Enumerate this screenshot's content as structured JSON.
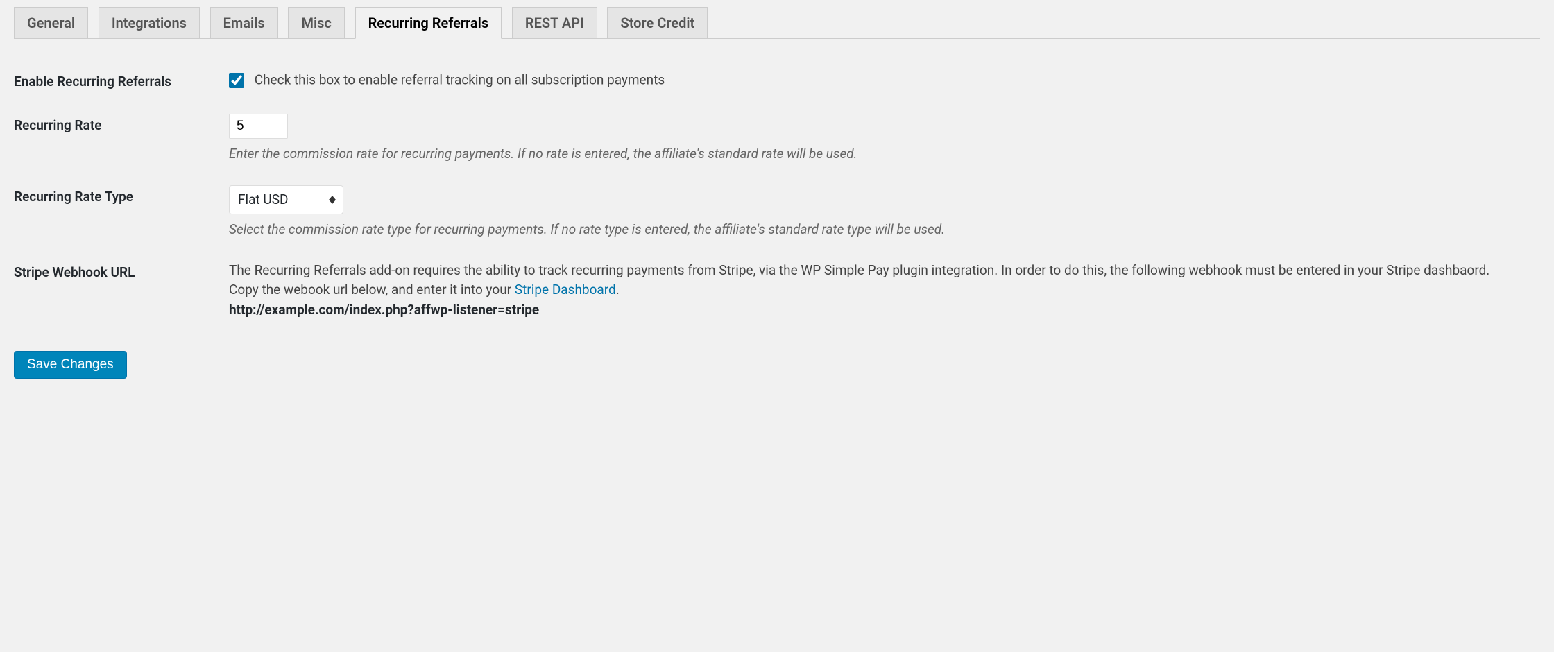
{
  "tabs": {
    "general": "General",
    "integrations": "Integrations",
    "emails": "Emails",
    "misc": "Misc",
    "recurring_referrals": "Recurring Referrals",
    "rest_api": "REST API",
    "store_credit": "Store Credit"
  },
  "fields": {
    "enable_recurring": {
      "label": "Enable Recurring Referrals",
      "description": "Check this box to enable referral tracking on all subscription payments",
      "checked": true
    },
    "recurring_rate": {
      "label": "Recurring Rate",
      "value": "5",
      "description": "Enter the commission rate for recurring payments. If no rate is entered, the affiliate's standard rate will be used."
    },
    "recurring_rate_type": {
      "label": "Recurring Rate Type",
      "selected": "Flat USD",
      "description": "Select the commission rate type for recurring payments. If no rate type is entered, the affiliate's standard rate type will be used."
    },
    "stripe_webhook": {
      "label": "Stripe Webhook URL",
      "text1": "The Recurring Referrals add-on requires the ability to track recurring payments from Stripe, via the WP Simple Pay plugin integration. In order to do this, the following webhook must be entered in your Stripe dashbaord.",
      "text2_prefix": "Copy the webook url below, and enter it into your ",
      "link_text": "Stripe Dashboard",
      "text2_suffix": ".",
      "url": "http://example.com/index.php?affwp-listener=stripe"
    }
  },
  "button": {
    "save": "Save Changes"
  }
}
